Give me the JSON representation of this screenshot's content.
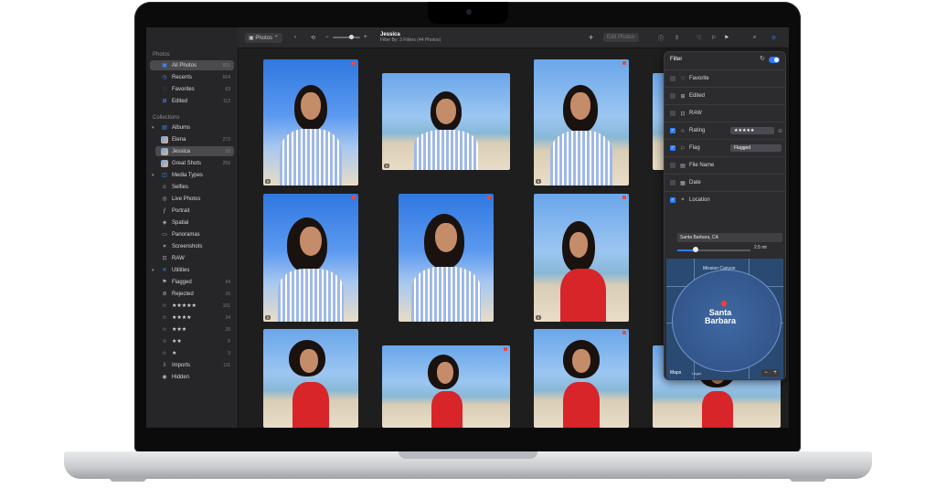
{
  "sidebar": {
    "photos_title": "Photos",
    "library": [
      {
        "label": "All Photos",
        "count": "651",
        "icon": "photo-library-icon"
      },
      {
        "label": "Recents",
        "count": "654",
        "icon": "clock-icon"
      },
      {
        "label": "Favorites",
        "count": "63",
        "icon": "heart-icon"
      },
      {
        "label": "Edited",
        "count": "112",
        "icon": "edit-icon"
      }
    ],
    "collections_title": "Collections",
    "albums_label": "Albums",
    "albums": [
      {
        "label": "Elena",
        "count": "272"
      },
      {
        "label": "Jessica",
        "count": "53"
      },
      {
        "label": "Great Shots",
        "count": "259"
      }
    ],
    "media_types_label": "Media Types",
    "media_types": [
      "Selfies",
      "Live Photos",
      "Portrait",
      "Spatial",
      "Panoramas",
      "Screenshots",
      "RAW"
    ],
    "utilities_label": "Utilities",
    "utilities": [
      {
        "label": "Flagged",
        "count": "94"
      },
      {
        "label": "Rejected",
        "count": "16"
      },
      {
        "label": "★★★★★",
        "count": "101"
      },
      {
        "label": "★★★★",
        "count": "34"
      },
      {
        "label": "★★★",
        "count": "29"
      },
      {
        "label": "★★",
        "count": "5"
      },
      {
        "label": "★",
        "count": "3"
      },
      {
        "label": "Imports",
        "count": "111"
      },
      {
        "label": "Hidden",
        "count": ""
      }
    ]
  },
  "toolbar": {
    "source_label": "Photos",
    "title": "Jessica",
    "subtitle": "Filter By: 3 Filters (44 Photos)",
    "edit_label": "Edit Photos"
  },
  "filter": {
    "title": "Filter",
    "rows": [
      {
        "label": "Favorite",
        "checked": false,
        "icon": "heart-icon"
      },
      {
        "label": "Edited",
        "checked": false,
        "icon": "edit-icon"
      },
      {
        "label": "RAW",
        "checked": false,
        "icon": "raw-icon"
      },
      {
        "label": "Rating",
        "checked": true,
        "icon": "star-icon",
        "value": "★★★★★"
      },
      {
        "label": "Flag",
        "checked": true,
        "icon": "flag-icon",
        "value": "Flagged"
      },
      {
        "label": "File Name",
        "checked": false,
        "icon": "file-icon"
      },
      {
        "label": "Date",
        "checked": false,
        "icon": "calendar-icon"
      },
      {
        "label": "Location",
        "checked": true,
        "icon": "location-icon"
      }
    ],
    "location_value": "Santa Barbara, CA",
    "radius_label": "2.5 mi",
    "radius_fraction": 0.25,
    "map": {
      "area_label": "Mission Canyon",
      "city_line1": "Santa",
      "city_line2": "Barbara",
      "brand": "Maps",
      "legal": "Legal"
    }
  },
  "photos": {
    "count_badge": "5"
  },
  "colors": {
    "accent": "#2f7cf6",
    "flag": "#e84a3c"
  }
}
